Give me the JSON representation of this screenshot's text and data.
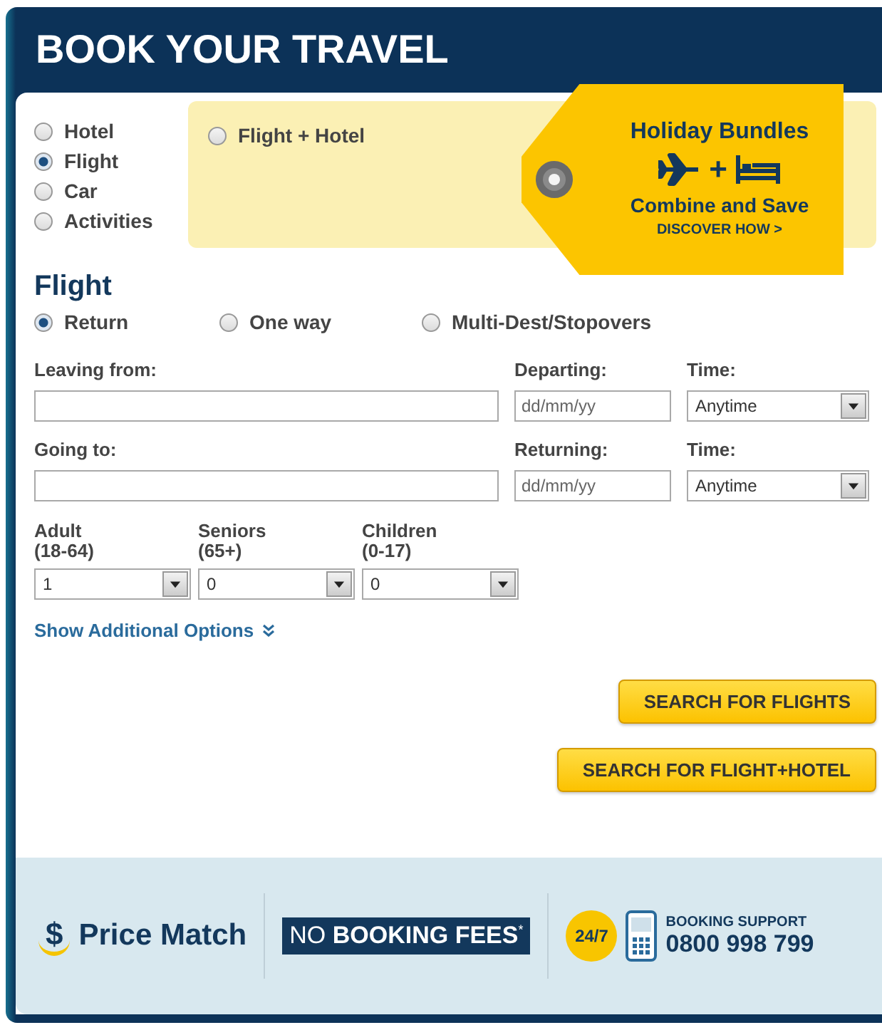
{
  "header": {
    "title": "BOOK YOUR TRAVEL"
  },
  "products": [
    {
      "label": "Hotel",
      "selected": false
    },
    {
      "label": "Flight",
      "selected": true
    },
    {
      "label": "Car",
      "selected": false
    },
    {
      "label": "Activities",
      "selected": false
    }
  ],
  "bundle_option": {
    "label": "Flight + Hotel",
    "selected": false
  },
  "promo_tag": {
    "title": "Holiday Bundles",
    "plus": "+",
    "subtitle": "Combine and Save",
    "link": "DISCOVER HOW >"
  },
  "flight": {
    "title": "Flight",
    "trip_types": [
      {
        "label": "Return",
        "selected": true
      },
      {
        "label": "One way",
        "selected": false
      },
      {
        "label": "Multi-Dest/Stopovers",
        "selected": false
      }
    ],
    "legs": [
      {
        "place_label": "Leaving from:",
        "date_label": "Departing:",
        "date_placeholder": "dd/mm/yy",
        "time_label": "Time:",
        "time_value": "Anytime"
      },
      {
        "place_label": "Going to:",
        "date_label": "Returning:",
        "date_placeholder": "dd/mm/yy",
        "time_label": "Time:",
        "time_value": "Anytime"
      }
    ],
    "passengers": [
      {
        "label": "Adult",
        "range": "(18-64)",
        "value": "1"
      },
      {
        "label": "Seniors",
        "range": "(65+)",
        "value": "0"
      },
      {
        "label": "Children",
        "range": "(0-17)",
        "value": "0"
      }
    ],
    "more_options": "Show Additional Options"
  },
  "buttons": [
    "SEARCH FOR FLIGHTS",
    "SEARCH FOR FLIGHT+HOTEL"
  ],
  "footer": {
    "price_match": {
      "symbol": "$",
      "text": "Price Match"
    },
    "fees_badge": "NO **BOOKING FEES**$^{*}$",
    "support": {
      "hours": "24/7",
      "label": "BOOKING SUPPORT",
      "phone": "0800 998 799"
    }
  }
}
